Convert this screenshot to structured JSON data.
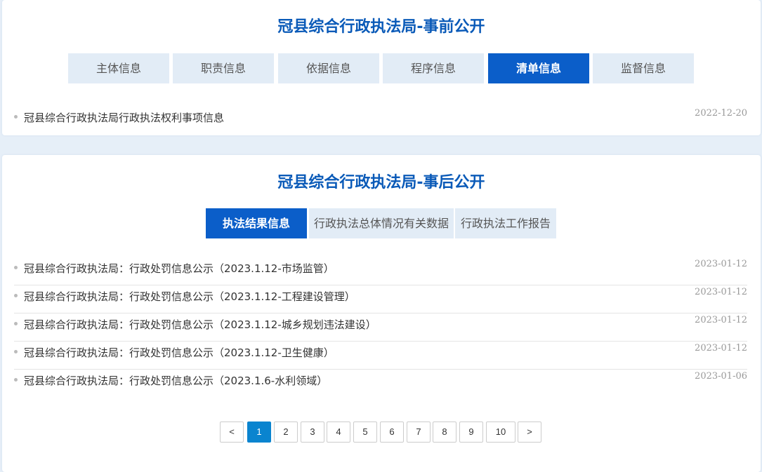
{
  "pre_section": {
    "title": "冠县综合行政执法局-事前公开",
    "tabs": [
      {
        "label": "主体信息"
      },
      {
        "label": "职责信息"
      },
      {
        "label": "依据信息"
      },
      {
        "label": "程序信息"
      },
      {
        "label": "清单信息"
      },
      {
        "label": "监督信息"
      }
    ],
    "active_tab": "清单信息",
    "items": [
      {
        "title": "冠县综合行政执法局行政执法权利事项信息",
        "date": "2022-12-20"
      }
    ]
  },
  "post_section": {
    "title": "冠县综合行政执法局-事后公开",
    "tabs": [
      {
        "label": "执法结果信息"
      },
      {
        "label": "行政执法总体情况有关数据"
      },
      {
        "label": "行政执法工作报告"
      }
    ],
    "active_tab": "执法结果信息",
    "items": [
      {
        "title": "冠县综合行政执法局：行政处罚信息公示（2023.1.12-市场监管）",
        "date": "2023-01-12"
      },
      {
        "title": "冠县综合行政执法局：行政处罚信息公示（2023.1.12-工程建设管理）",
        "date": "2023-01-12"
      },
      {
        "title": "冠县综合行政执法局：行政处罚信息公示（2023.1.12-城乡规划违法建设）",
        "date": "2023-01-12"
      },
      {
        "title": "冠县综合行政执法局：行政处罚信息公示（2023.1.12-卫生健康）",
        "date": "2023-01-12"
      },
      {
        "title": "冠县综合行政执法局：行政处罚信息公示（2023.1.6-水利领域）",
        "date": "2023-01-06"
      }
    ]
  },
  "pagination": {
    "prev": "<",
    "next": ">",
    "pages": [
      "1",
      "2",
      "3",
      "4",
      "5",
      "6",
      "7",
      "8",
      "9",
      "10"
    ],
    "current": "1"
  },
  "colors": {
    "accent": "#0b5ec9",
    "title": "#0a5ab8",
    "tab_bg": "#e2ecf6",
    "page_bg": "#e6eff8",
    "pager_active": "#0a84cf"
  }
}
